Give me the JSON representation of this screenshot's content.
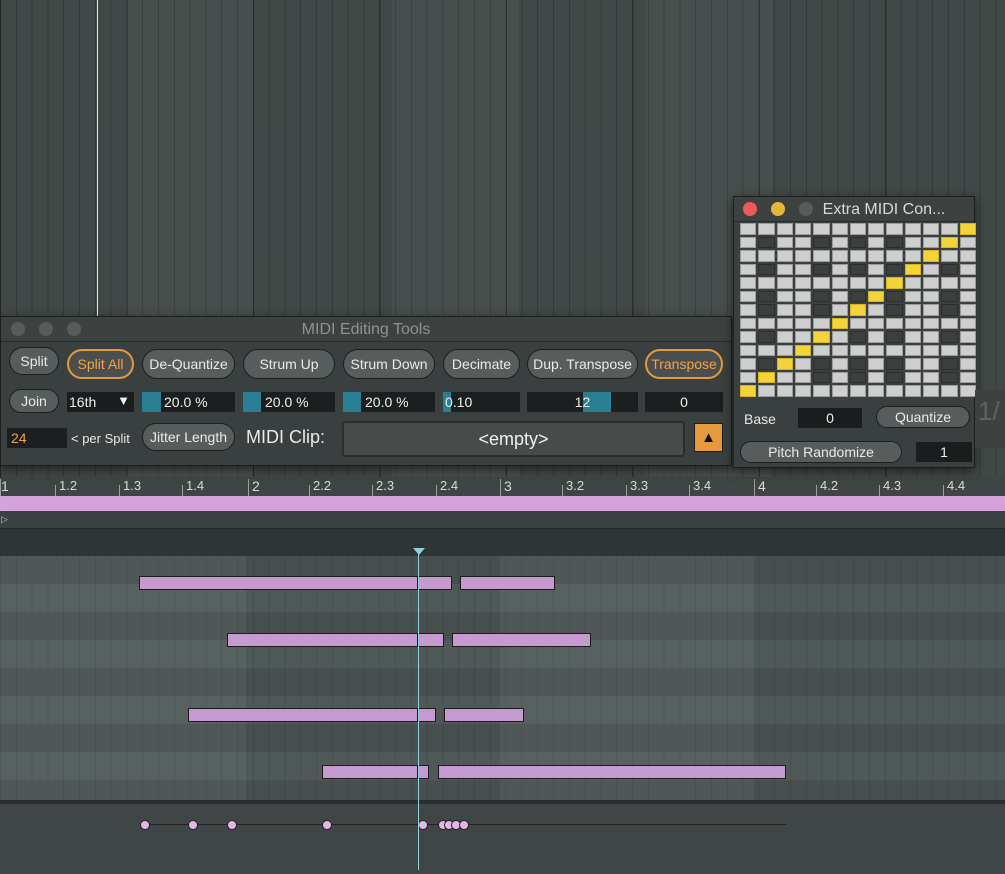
{
  "midi_editing_tools": {
    "title": "MIDI Editing Tools",
    "buttons": {
      "split": "Split",
      "split_all": "Split All",
      "de_quantize": "De-Quantize",
      "strum_up": "Strum Up",
      "strum_down": "Strum Down",
      "decimate": "Decimate",
      "dup_transpose": "Dup. Transpose",
      "transpose": "Transpose",
      "join": "Join",
      "jitter_length": "Jitter Length"
    },
    "split_division": "16th",
    "de_quantize_amount": "20.0 %",
    "de_quantize_fraction": 0.2,
    "strum_up_amount": "20.0 %",
    "strum_up_fraction": 0.2,
    "strum_down_amount": "20.0 %",
    "strum_down_fraction": 0.2,
    "decimate_amount": "0.10",
    "decimate_fraction": 0.1,
    "dup_transpose_amount": "12",
    "dup_transpose_fraction": 0.5,
    "transpose_amount": "0",
    "per_split_value": "24",
    "per_split_label": "< per Split",
    "midi_clip_label": "MIDI Clip:",
    "midi_clip_value": "<empty>"
  },
  "extra_midi": {
    "title": "Extra MIDI Con...",
    "base_label": "Base",
    "base_value": "0",
    "quantize_label": "Quantize",
    "pitch_randomize_label": "Pitch Randomize",
    "pitch_randomize_value": "1",
    "edge_text": "1/"
  },
  "ruler": {
    "labels": [
      "1",
      "1.2",
      "1.3",
      "1.4",
      "2",
      "2.2",
      "2.3",
      "2.4",
      "3",
      "3.2",
      "3.3",
      "3.4",
      "4",
      "4.2",
      "4.3",
      "4.4"
    ]
  },
  "colors": {
    "accent_orange": "#e69a3d",
    "note_fill": "#c69ad0",
    "playhead": "#8fd0de",
    "bar_fill": "#2a7f95",
    "grid_highlight": "#f3d53b"
  }
}
